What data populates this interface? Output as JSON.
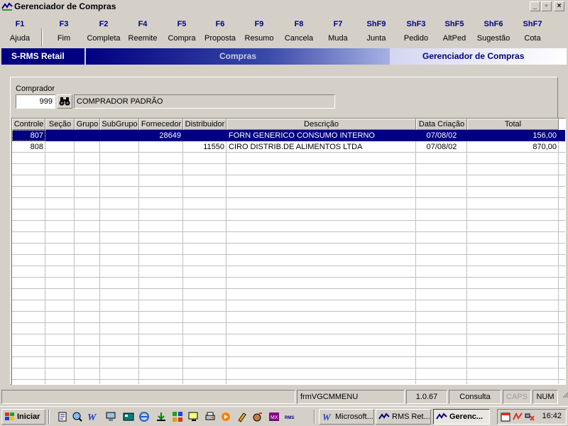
{
  "window": {
    "title": "Gerenciador de Compras",
    "minimize_glyph": "_",
    "maximize_glyph": "▫",
    "close_glyph": "×"
  },
  "toolbar": {
    "keys": [
      {
        "key": "F1",
        "label": "Ajuda"
      },
      {
        "key": "F3",
        "label": "Fim"
      },
      {
        "key": "F2",
        "label": "Completa"
      },
      {
        "key": "F4",
        "label": "Reemite"
      },
      {
        "key": "F5",
        "label": "Compra"
      },
      {
        "key": "F6",
        "label": "Proposta"
      },
      {
        "key": "F9",
        "label": "Resumo"
      },
      {
        "key": "F8",
        "label": "Cancela"
      },
      {
        "key": "F7",
        "label": "Muda"
      },
      {
        "key": "ShF9",
        "label": "Junta"
      },
      {
        "key": "ShF3",
        "label": "Pedido"
      },
      {
        "key": "ShF5",
        "label": "AltPed"
      },
      {
        "key": "ShF6",
        "label": "Sugestão"
      },
      {
        "key": "ShF7",
        "label": "Cota"
      }
    ]
  },
  "banner": {
    "system": "S-RMS Retail",
    "module": "Compras",
    "screen": "Gerenciador de Compras"
  },
  "comprador": {
    "label": "Comprador",
    "code": "999",
    "name": "COMPRADOR PADRÃO"
  },
  "grid": {
    "headers": [
      "Controle",
      "Seção",
      "Grupo",
      "SubGrupo",
      "Fornecedor",
      "Distribuidor",
      "Descrição",
      "Data Criação",
      "Total"
    ],
    "rows": [
      {
        "controle": "807",
        "secao": "",
        "grupo": "",
        "subgrupo": "",
        "fornecedor": "28649",
        "distribuidor": "",
        "descricao": "FORN GENERICO CONSUMO INTERNO",
        "data": "07/08/02",
        "total": "156,00"
      },
      {
        "controle": "808",
        "secao": "",
        "grupo": "",
        "subgrupo": "",
        "fornecedor": "",
        "distribuidor": "11550",
        "descricao": "CIRO DISTRIB.DE ALIMENTOS LTDA",
        "data": "07/08/02",
        "total": "870,00"
      }
    ],
    "selected_row": 0,
    "colors": {
      "selection": "#000080"
    }
  },
  "statusbar": {
    "form": "frmVGCMMENU",
    "version": "1.0.67",
    "mode": "Consulta",
    "caps": "CAPS",
    "num": "NUM"
  },
  "taskbar": {
    "start": "Iniciar",
    "tasks": [
      "Microsoft...",
      "RMS Ret...",
      "Gerenc..."
    ],
    "active_task": 2,
    "clock": "16:42"
  },
  "colors": {
    "window_bg": "#d4d0c8",
    "accent": "#000080",
    "fkey_text": "#000080"
  }
}
